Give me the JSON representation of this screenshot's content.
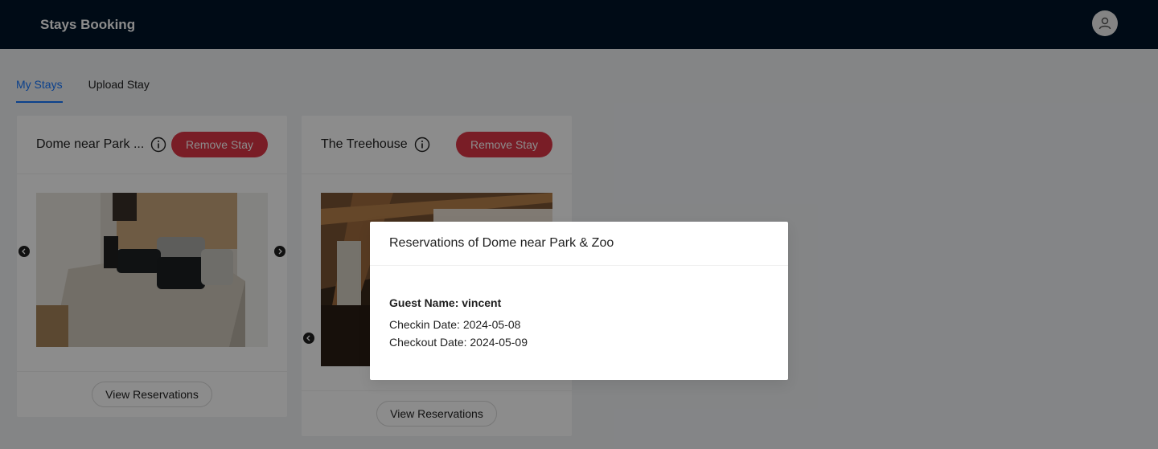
{
  "header": {
    "app_title": "Stays Booking",
    "avatar_icon": "user-icon"
  },
  "tabs": [
    {
      "label": "My Stays",
      "active": true
    },
    {
      "label": "Upload Stay",
      "active": false
    }
  ],
  "stays": [
    {
      "title": "Dome near Park ...",
      "remove_label": "Remove Stay",
      "view_label": "View Reservations",
      "image": "bedroom-photo"
    },
    {
      "title": "The Treehouse",
      "remove_label": "Remove Stay",
      "view_label": "View Reservations",
      "image": "treehouse-photo"
    }
  ],
  "modal": {
    "title": "Reservations of Dome near Park & Zoo",
    "guest_name": "Guest Name: vincent",
    "checkin": "Checkin Date: 2024-05-08",
    "checkout": "Checkout Date: 2024-05-09"
  },
  "colors": {
    "header_bg": "#001529",
    "accent": "#1677ff",
    "danger": "#dc3545"
  }
}
